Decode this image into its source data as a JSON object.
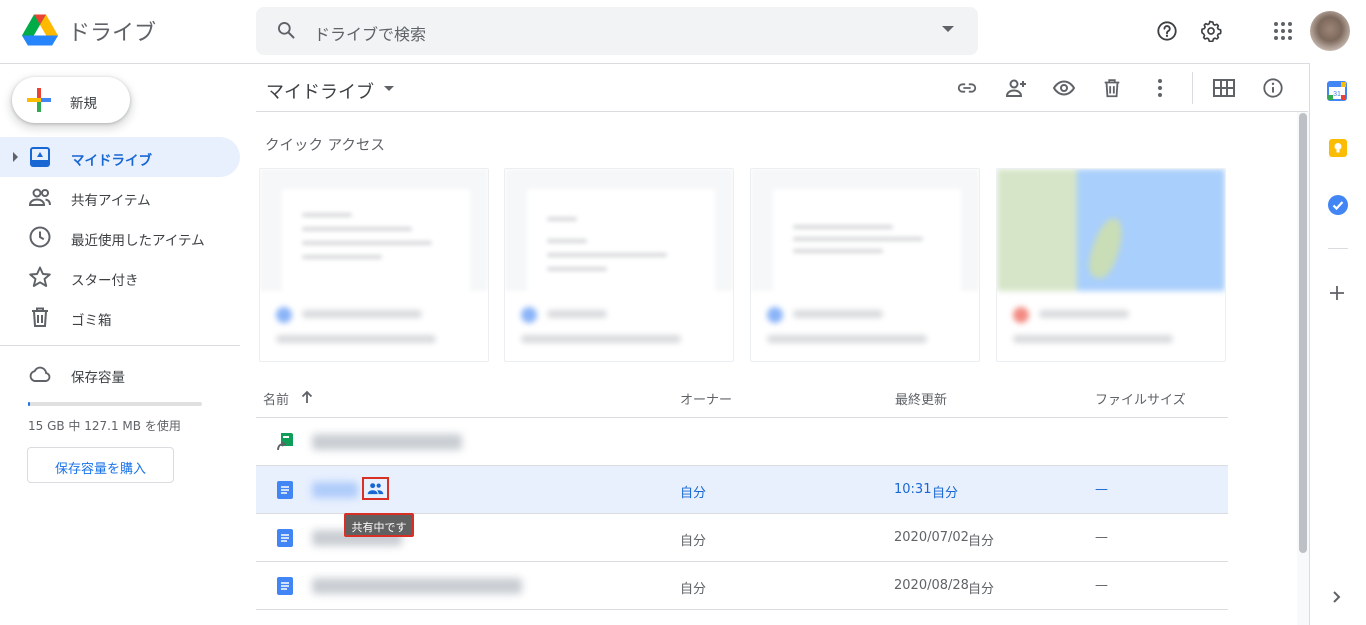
{
  "header": {
    "app_name": "ドライブ",
    "search_placeholder": "ドライブで検索"
  },
  "sidebar": {
    "new_label": "新規",
    "items": [
      {
        "label": "マイドライブ",
        "active": true
      },
      {
        "label": "共有アイテム"
      },
      {
        "label": "最近使用したアイテム"
      },
      {
        "label": "スター付き"
      },
      {
        "label": "ゴミ箱"
      }
    ],
    "storage_label": "保存容量",
    "storage_used_text": "15 GB 中 127.1 MB を使用",
    "storage_used_fraction": 0.008,
    "buy_storage_label": "保存容量を購入"
  },
  "main": {
    "title": "マイドライブ",
    "quick_access_title": "クイック アクセス",
    "columns": {
      "name": "名前",
      "owner": "オーナー",
      "modified": "最終更新",
      "size": "ファイルサイズ"
    },
    "rows": [
      {
        "owner": "",
        "modified_date": "",
        "modified_by": "",
        "size": ""
      },
      {
        "owner": "自分",
        "modified_date": "10:31",
        "modified_by": "自分",
        "size": "—"
      },
      {
        "owner": "自分",
        "modified_date": "2020/07/02",
        "modified_by": "自分",
        "size": "—"
      },
      {
        "owner": "自分",
        "modified_date": "2020/08/28",
        "modified_by": "自分",
        "size": "—"
      }
    ],
    "tooltip": "共有中です"
  },
  "colors": {
    "accent": "#1a73e8",
    "selected_row": "#e8f0fe",
    "highlight_red": "#d93025",
    "docs_blue": "#4285f4",
    "sheets_green": "#0f9d58"
  }
}
